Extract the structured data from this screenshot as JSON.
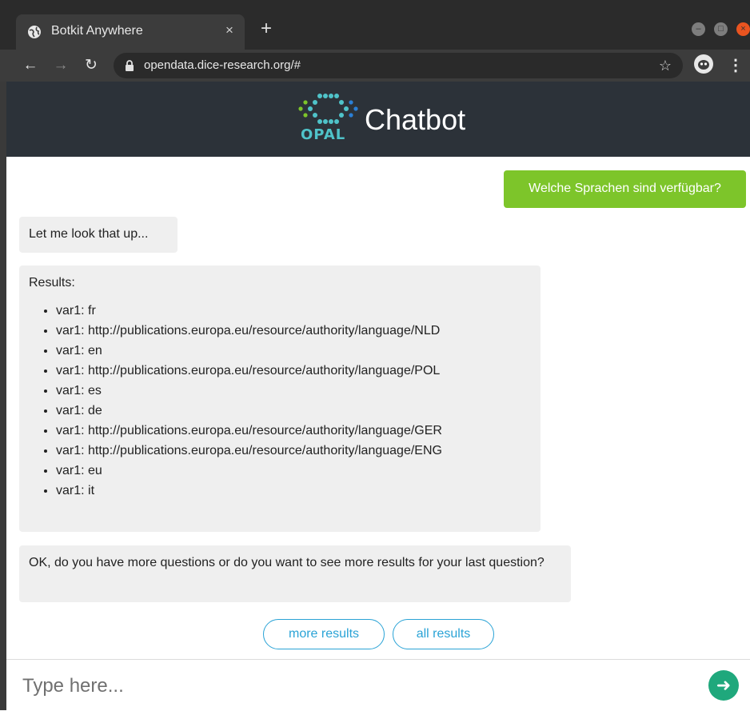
{
  "browser": {
    "tab_title": "Botkit Anywhere",
    "tab_close_glyph": "×",
    "new_tab_glyph": "+",
    "url": "opendata.dice-research.org/#",
    "icons": [
      "globe-icon",
      "close-icon",
      "plus-icon",
      "back-arrow-icon",
      "forward-arrow-icon",
      "reload-icon",
      "lock-icon",
      "star-icon",
      "profile-icon",
      "menu-icon"
    ]
  },
  "header": {
    "logo_text": "OPAL",
    "title": "Chatbot"
  },
  "conversation": {
    "user_message": "Welche Sprachen sind verfügbar?",
    "bot_1": "Let me look that up...",
    "bot_2_heading": "Results:",
    "results": [
      "var1: fr",
      "var1: http://publications.europa.eu/resource/authority/language/NLD",
      "var1: en",
      "var1: http://publications.europa.eu/resource/authority/language/POL",
      "var1: es",
      "var1: de",
      "var1: http://publications.europa.eu/resource/authority/language/GER",
      "var1: http://publications.europa.eu/resource/authority/language/ENG",
      "var1: eu",
      "var1: it"
    ],
    "bot_3": "OK, do you have more questions or do you want to see more results for your last question?"
  },
  "quick_replies": {
    "more": "more results",
    "all": "all results"
  },
  "composer": {
    "placeholder": "Type here..."
  },
  "colors": {
    "header_bg": "#2c3239",
    "user_bubble": "#7dc52a",
    "bot_bubble": "#efefef",
    "chip_accent": "#2aa3d6",
    "send_button": "#1fa87c"
  }
}
